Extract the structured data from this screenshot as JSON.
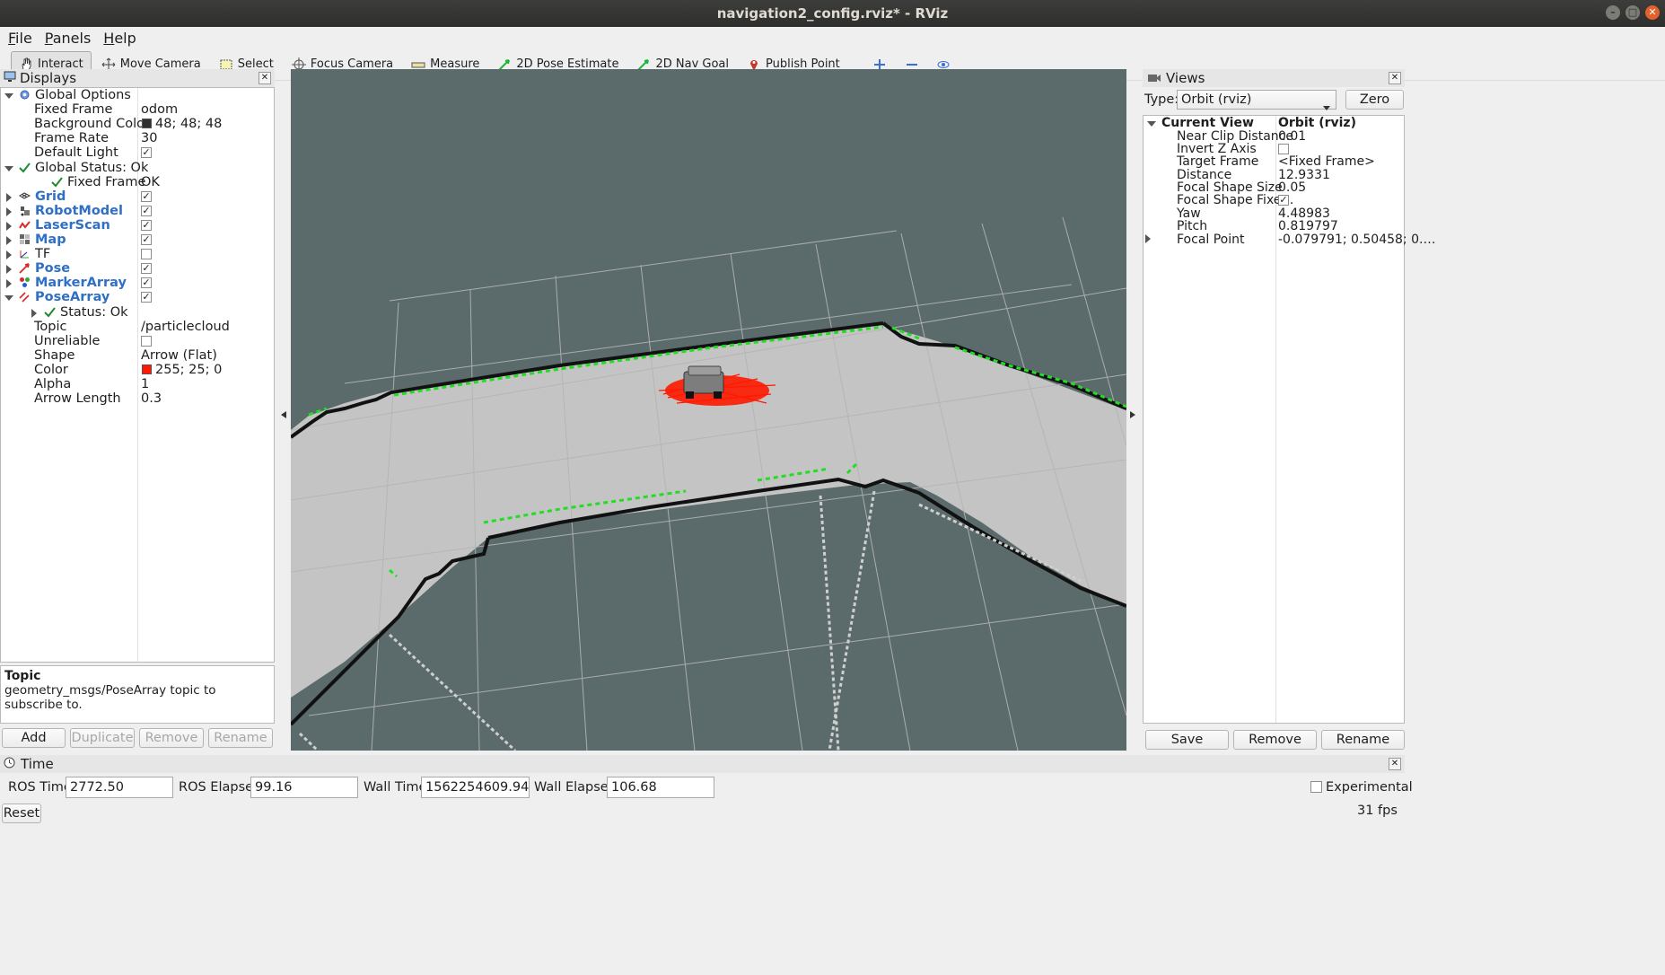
{
  "window": {
    "title": "navigation2_config.rviz* - RViz"
  },
  "menu": [
    "File",
    "Panels",
    "Help"
  ],
  "toolbar": [
    {
      "label": "Interact",
      "icon": "hand-icon"
    },
    {
      "label": "Move Camera",
      "icon": "move-camera-icon"
    },
    {
      "label": "Select",
      "icon": "select-icon"
    },
    {
      "label": "Focus Camera",
      "icon": "focus-camera-icon"
    },
    {
      "label": "Measure",
      "icon": "ruler-icon"
    },
    {
      "label": "2D Pose Estimate",
      "icon": "pose-arrow-icon"
    },
    {
      "label": "2D Nav Goal",
      "icon": "nav-goal-icon"
    },
    {
      "label": "Publish Point",
      "icon": "map-pin-icon"
    }
  ],
  "displays": {
    "title": "Displays",
    "rows": [
      {
        "name": "Global Options",
        "value": ""
      },
      {
        "name": "Fixed Frame",
        "value": "odom"
      },
      {
        "name": "Background Color",
        "value": "48; 48; 48"
      },
      {
        "name": "Frame Rate",
        "value": "30"
      },
      {
        "name": "Default Light",
        "value": ""
      },
      {
        "name": "Global Status: Ok",
        "value": ""
      },
      {
        "name": "Fixed Frame",
        "value": "OK"
      },
      {
        "name": "Grid",
        "value": ""
      },
      {
        "name": "RobotModel",
        "value": ""
      },
      {
        "name": "LaserScan",
        "value": ""
      },
      {
        "name": "Map",
        "value": ""
      },
      {
        "name": "TF",
        "value": ""
      },
      {
        "name": "Pose",
        "value": ""
      },
      {
        "name": "MarkerArray",
        "value": ""
      },
      {
        "name": "PoseArray",
        "value": ""
      },
      {
        "name": "Status: Ok",
        "value": ""
      },
      {
        "name": "Topic",
        "value": "/particlecloud"
      },
      {
        "name": "Unreliable",
        "value": ""
      },
      {
        "name": "Shape",
        "value": "Arrow (Flat)"
      },
      {
        "name": "Color",
        "value": "255; 25; 0"
      },
      {
        "name": "Alpha",
        "value": "1"
      },
      {
        "name": "Arrow Length",
        "value": "0.3"
      }
    ],
    "help_title": "Topic",
    "help_text": "geometry_msgs/PoseArray topic to subscribe to.",
    "buttons": [
      "Add",
      "Duplicate",
      "Remove",
      "Rename"
    ]
  },
  "views": {
    "title": "Views",
    "type_label": "Type:",
    "type_value": "Orbit (rviz)",
    "zero": "Zero",
    "current_view": "Current View",
    "current_view_value": "Orbit (rviz)",
    "rows": [
      {
        "name": "Near Clip Distance",
        "value": "0.01"
      },
      {
        "name": "Invert Z Axis",
        "value": ""
      },
      {
        "name": "Target Frame",
        "value": "<Fixed Frame>"
      },
      {
        "name": "Distance",
        "value": "12.9331"
      },
      {
        "name": "Focal Shape Size",
        "value": "0.05"
      },
      {
        "name": "Focal Shape Fixe…",
        "value": ""
      },
      {
        "name": "Yaw",
        "value": "4.48983"
      },
      {
        "name": "Pitch",
        "value": "0.819797"
      },
      {
        "name": "Focal Point",
        "value": "-0.079791; 0.50458; 0.…"
      }
    ],
    "buttons": [
      "Save",
      "Remove",
      "Rename"
    ]
  },
  "time": {
    "title": "Time",
    "ros_time_label": "ROS Time:",
    "ros_time": "2772.50",
    "ros_elapsed_label": "ROS Elapsed:",
    "ros_elapsed": "99.16",
    "wall_time_label": "Wall Time:",
    "wall_time": "1562254609.94",
    "wall_elapsed_label": "Wall Elapsed:",
    "wall_elapsed": "106.68",
    "experimental": "Experimental",
    "reset": "Reset",
    "fps": "31 fps"
  },
  "colors": {
    "viewport_bg": "#5b6b6b",
    "floor": "#c3c3c3",
    "scan": "#22dd22",
    "particles": "#ff1900",
    "accent": "#2e6fc7"
  }
}
